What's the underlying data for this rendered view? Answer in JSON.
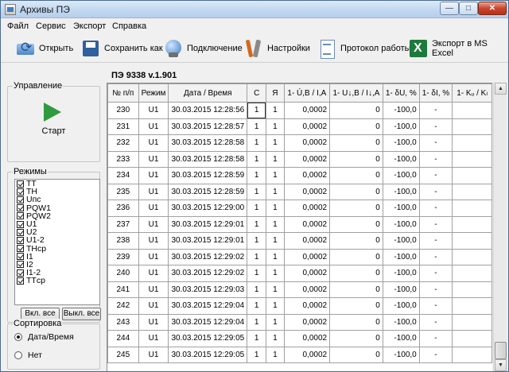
{
  "window": {
    "title": "Архивы ПЭ",
    "minimize": "—",
    "maximize": "□",
    "close": "✕"
  },
  "menu": [
    "Файл",
    "Сервис",
    "Экспорт",
    "Справка"
  ],
  "toolbar": {
    "open": "Открыть",
    "save_as": "Сохранить как",
    "connect": "Подключение",
    "settings": "Настройки",
    "protocol": "Протокол работы",
    "export_excel": "Экспорт в MS Excel"
  },
  "control": {
    "title": "Управление",
    "start": "Старт"
  },
  "modes": {
    "title": "Режимы",
    "items": [
      "ТТ",
      "ТН",
      "Uпс",
      "PQW1",
      "PQW2",
      "U1",
      "U2",
      "U1-2",
      "THср",
      "I1",
      "I2",
      "I1-2",
      "TTср"
    ],
    "select_all": "Вкл. все",
    "deselect_all": "Выкл. все"
  },
  "sort": {
    "title": "Сортировка",
    "option_date": "Дата/Время",
    "option_none": "Нет",
    "selected": "Дата/Время"
  },
  "device_title": "ПЭ 9338 v.1.901",
  "table": {
    "columns": [
      "№ п/п",
      "Режим",
      "Дата / Время",
      "С",
      "Я",
      "1- Ú,B / I,A",
      "1- U↓,B / I↓,A",
      "1- δU, %",
      "1- δI, %",
      "1- Kᵤ / Kₗ"
    ],
    "rows": [
      [
        "230",
        "U1",
        "30.03.2015 12:28:56",
        "1",
        "1",
        "0,0002",
        "0",
        "-100,0",
        "-",
        ""
      ],
      [
        "231",
        "U1",
        "30.03.2015 12:28:57",
        "1",
        "1",
        "0,0002",
        "0",
        "-100,0",
        "-",
        ""
      ],
      [
        "232",
        "U1",
        "30.03.2015 12:28:58",
        "1",
        "1",
        "0,0002",
        "0",
        "-100,0",
        "-",
        ""
      ],
      [
        "233",
        "U1",
        "30.03.2015 12:28:58",
        "1",
        "1",
        "0,0002",
        "0",
        "-100,0",
        "-",
        ""
      ],
      [
        "234",
        "U1",
        "30.03.2015 12:28:59",
        "1",
        "1",
        "0,0002",
        "0",
        "-100,0",
        "-",
        ""
      ],
      [
        "235",
        "U1",
        "30.03.2015 12:28:59",
        "1",
        "1",
        "0,0002",
        "0",
        "-100,0",
        "-",
        ""
      ],
      [
        "236",
        "U1",
        "30.03.2015 12:29:00",
        "1",
        "1",
        "0,0002",
        "0",
        "-100,0",
        "-",
        ""
      ],
      [
        "237",
        "U1",
        "30.03.2015 12:29:01",
        "1",
        "1",
        "0,0002",
        "0",
        "-100,0",
        "-",
        ""
      ],
      [
        "238",
        "U1",
        "30.03.2015 12:29:01",
        "1",
        "1",
        "0,0002",
        "0",
        "-100,0",
        "-",
        ""
      ],
      [
        "239",
        "U1",
        "30.03.2015 12:29:02",
        "1",
        "1",
        "0,0002",
        "0",
        "-100,0",
        "-",
        ""
      ],
      [
        "240",
        "U1",
        "30.03.2015 12:29:02",
        "1",
        "1",
        "0,0002",
        "0",
        "-100,0",
        "-",
        ""
      ],
      [
        "241",
        "U1",
        "30.03.2015 12:29:03",
        "1",
        "1",
        "0,0002",
        "0",
        "-100,0",
        "-",
        ""
      ],
      [
        "242",
        "U1",
        "30.03.2015 12:29:04",
        "1",
        "1",
        "0,0002",
        "0",
        "-100,0",
        "-",
        ""
      ],
      [
        "243",
        "U1",
        "30.03.2015 12:29:04",
        "1",
        "1",
        "0,0002",
        "0",
        "-100,0",
        "-",
        ""
      ],
      [
        "244",
        "U1",
        "30.03.2015 12:29:05",
        "1",
        "1",
        "0,0002",
        "0",
        "-100,0",
        "-",
        ""
      ],
      [
        "245",
        "U1",
        "30.03.2015 12:29:05",
        "1",
        "1",
        "0,0002",
        "0",
        "-100,0",
        "-",
        ""
      ]
    ]
  },
  "scrollbar": {
    "up": "▲",
    "down": "▼"
  }
}
